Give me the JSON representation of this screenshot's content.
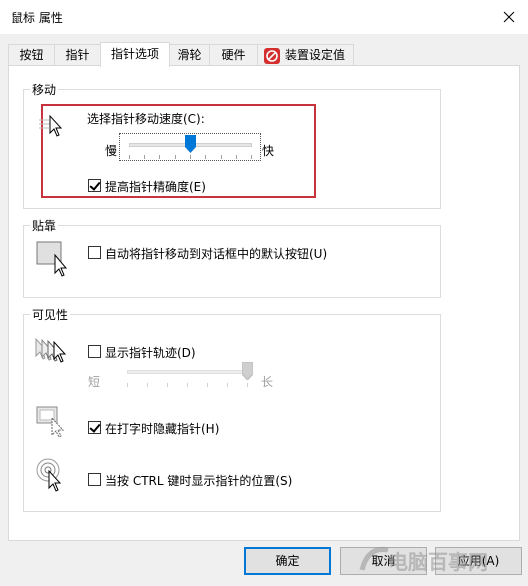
{
  "window": {
    "title": "鼠标 属性"
  },
  "tabs": [
    {
      "label": "按钮"
    },
    {
      "label": "指针"
    },
    {
      "label": "指针选项",
      "active": true
    },
    {
      "label": "滑轮"
    },
    {
      "label": "硬件"
    },
    {
      "label": "装置设定值"
    }
  ],
  "motion": {
    "group_title": "移动",
    "speed_label": "选择指针移动速度(C):",
    "slow_label": "慢",
    "fast_label": "快",
    "speed_value_fraction": 0.5,
    "precision_label": "提高指针精确度(E)",
    "precision_checked": true
  },
  "snap": {
    "group_title": "贴靠",
    "snap_label": "自动将指针移动到对话框中的默认按钮(U)",
    "snap_checked": false
  },
  "visibility": {
    "group_title": "可见性",
    "trails_label": "显示指针轨迹(D)",
    "trails_checked": false,
    "short_label": "短",
    "long_label": "长",
    "trail_value_fraction": 1.0,
    "hide_typing_label": "在打字时隐藏指针(H)",
    "hide_typing_checked": true,
    "ctrl_label": "当按 CTRL 键时显示指针的位置(S)",
    "ctrl_checked": false
  },
  "buttons": {
    "ok": "确定",
    "cancel": "取消",
    "apply": "应用(A)"
  },
  "watermark": "电脑百事网",
  "colors": {
    "highlight": "#c8323c",
    "thumb": "#0078d7",
    "default_border": "#0078d7"
  }
}
